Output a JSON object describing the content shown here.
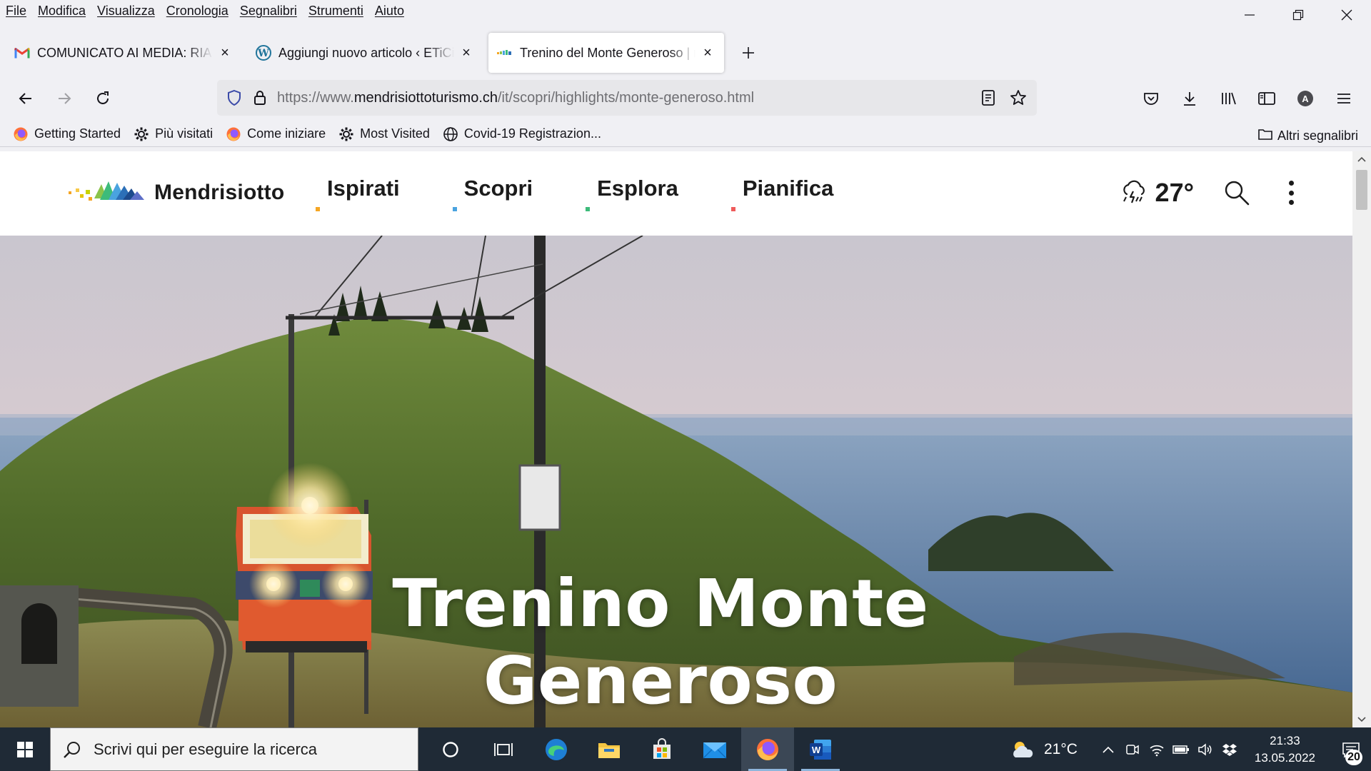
{
  "menubar": {
    "items": [
      "File",
      "Modifica",
      "Visualizza",
      "Cronologia",
      "Segnalibri",
      "Strumenti",
      "Aiuto"
    ]
  },
  "tabs": [
    {
      "title": "COMUNICATO AI MEDIA: RIAPR",
      "icon": "gmail-icon",
      "active": false
    },
    {
      "title": "Aggiungi nuovo articolo ‹ ETiCi",
      "icon": "wordpress-icon",
      "active": false
    },
    {
      "title": "Trenino del Monte Generoso | m",
      "icon": "mendrisiotto-icon",
      "active": true
    }
  ],
  "urlbar": {
    "prefix": "https://www.",
    "domain": "mendrisiottoturismo.ch",
    "path": "/it/scopri/highlights/monte-generoso.html"
  },
  "bookmarks": [
    {
      "label": "Getting Started",
      "icon": "firefox-icon"
    },
    {
      "label": "Più visitati",
      "icon": "gear-icon"
    },
    {
      "label": "Come iniziare",
      "icon": "firefox-icon"
    },
    {
      "label": "Most Visited",
      "icon": "gear-icon"
    },
    {
      "label": "Covid-19 Registrazion...",
      "icon": "globe-icon"
    }
  ],
  "other_bookmarks": "Altri segnalibri",
  "site": {
    "logo": "Mendrisiotto",
    "nav": [
      {
        "label": "Ispirati",
        "color": "#f5a623"
      },
      {
        "label": "Scopri",
        "color": "#4aa3df"
      },
      {
        "label": "Esplora",
        "color": "#3dbb7a"
      },
      {
        "label": "Pianifica",
        "color": "#ef5b5b"
      }
    ],
    "temperature": "27°",
    "hero_title_line1": "Trenino Monte",
    "hero_title_line2": "Generoso"
  },
  "taskbar": {
    "search_placeholder": "Scrivi qui per eseguire la ricerca",
    "weather": "21°C",
    "time": "21:33",
    "date": "13.05.2022",
    "notifications": "20"
  },
  "colors": {
    "chrome_bg": "#f0f0f4",
    "urlbar_bg": "#e7e7ea",
    "taskbar_bg": "#1f2a36"
  }
}
